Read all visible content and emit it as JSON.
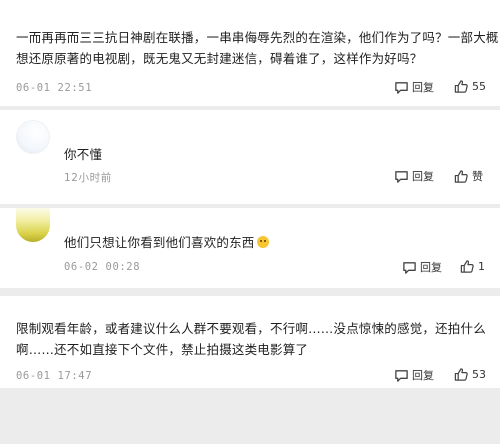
{
  "comments": [
    {
      "line1": "一而再再而三三抗日神剧在联播，一串串侮辱先烈的在渲染，他们作为了吗？一部大概",
      "line2": "想还原原著的电视剧，既无鬼又无封建迷信，碍着谁了，这样作为好吗？",
      "time": "06-01 22:51",
      "reply_label": "回复",
      "like_count": "55"
    },
    {
      "line1": "你不懂",
      "time": "12小时前",
      "reply_label": "回复",
      "like_label": "赞"
    },
    {
      "line1": "他们只想让你看到他们喜欢的东西",
      "time": "06-02 00:28",
      "reply_label": "回复",
      "like_count": "1"
    },
    {
      "line1": "限制观看年龄，或者建议什么人群不要观看，不行啊……没点惊悚的感觉，还拍什么",
      "line2": "啊……还不如直接下个文件，禁止拍摄这类电影算了",
      "time": "06-01 17:47",
      "reply_label": "回复",
      "like_count": "53"
    }
  ],
  "icons": {
    "reply": "speech-bubble-icon",
    "like": "thumbs-up-icon",
    "emoji": "smile-emoji-icon"
  },
  "colors": {
    "background": "#ececec",
    "card": "#ffffff",
    "meta_text": "#9a9a9a"
  }
}
